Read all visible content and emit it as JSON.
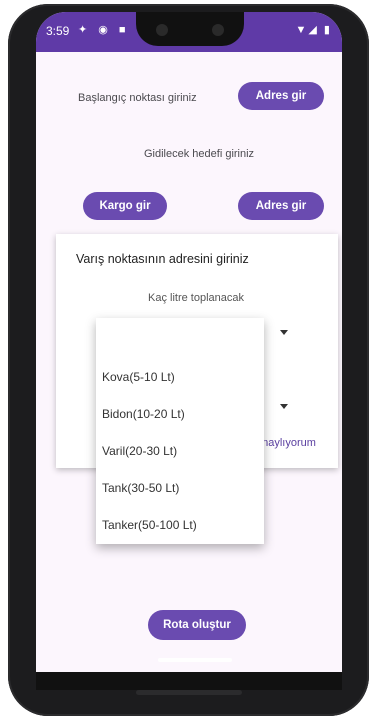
{
  "status_bar": {
    "time": "3:59"
  },
  "form": {
    "start_prompt": "Başlangıç noktası giriniz",
    "start_button": "Adres gir",
    "destination_prompt": "Gidilecek hedefi giriniz",
    "cargo_button": "Kargo gir",
    "destination_button": "Adres gir"
  },
  "card": {
    "title": "Varış noktasının adresini giriniz",
    "subtitle": "Kaç litre toplanacak",
    "confirm_partial": "onaylıyorum"
  },
  "dropdown": {
    "options": [
      {
        "label": "Kova(5-10 Lt)"
      },
      {
        "label": "Bidon(10-20 Lt)"
      },
      {
        "label": "Varil(20-30 Lt)"
      },
      {
        "label": "Tank(30-50 Lt)"
      },
      {
        "label": "Tanker(50-100 Lt)"
      }
    ]
  },
  "footer": {
    "create_route_button": "Rota oluştur"
  },
  "colors": {
    "primary": "#6a4bb0",
    "status_bar": "#5f3aa7",
    "background": "#fcf6fd"
  }
}
